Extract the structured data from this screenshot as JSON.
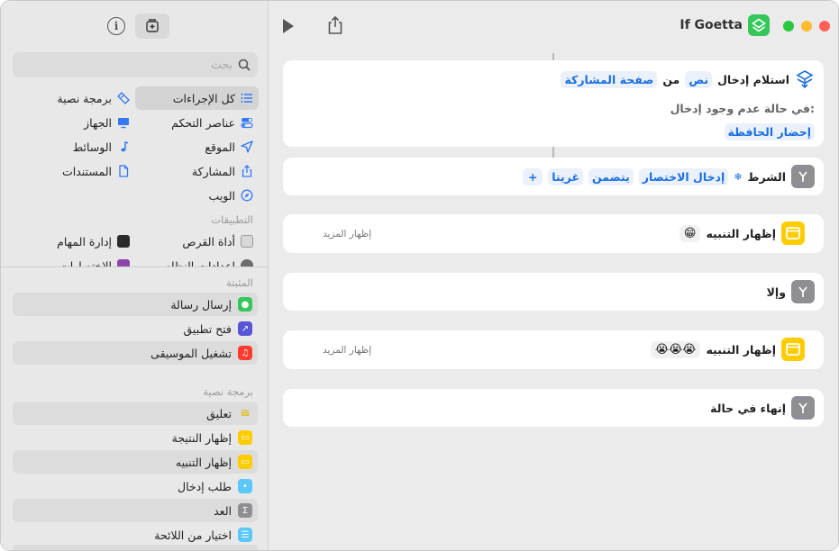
{
  "window": {
    "title": "If Goetta"
  },
  "sidebar": {
    "search_placeholder": "بحث",
    "categories": [
      {
        "label": "كل الإجراءات",
        "icon": "list-icon"
      },
      {
        "label": "برمجة نصية",
        "icon": "scripting-icon"
      },
      {
        "label": "عناصر التحكم",
        "icon": "toggle-icon"
      },
      {
        "label": "الجهاز",
        "icon": "display-icon"
      },
      {
        "label": "الموقع",
        "icon": "location-arrow-icon"
      },
      {
        "label": "الوسائط",
        "icon": "music-note-icon"
      },
      {
        "label": "المشاركة",
        "icon": "share-icon"
      },
      {
        "label": "المستندات",
        "icon": "document-icon"
      },
      {
        "label": "الويب",
        "icon": "compass-icon"
      }
    ],
    "apps_label": "التطبيقات",
    "apps": [
      {
        "label": "أداة القرص",
        "icon": "disk-utility-icon"
      },
      {
        "label": "إدارة المهام",
        "icon": "activity-monitor-icon"
      },
      {
        "label": "إعدادات النظام",
        "icon": "system-settings-icon"
      },
      {
        "label": "الاختصارات",
        "icon": "shortcuts-app-icon"
      }
    ],
    "pinned_label": "المثبتة",
    "pinned": [
      {
        "label": "إرسال رسالة",
        "color": "#34c759"
      },
      {
        "label": "فتح تطبيق",
        "color": "#5856d6"
      },
      {
        "label": "تشغيل الموسيقى",
        "color": "#ff3b30"
      }
    ],
    "scripting_label": "برمجة نصية",
    "scripting": [
      {
        "label": "تعليق",
        "color": "#ffcc00"
      },
      {
        "label": "إظهار النتيجة",
        "color": "#ffcc00"
      },
      {
        "label": "إظهار التنبيه",
        "color": "#ffcc00"
      },
      {
        "label": "طلب إدخال",
        "color": "#5ac8fa"
      },
      {
        "label": "العد",
        "color": "#8e8e93"
      },
      {
        "label": "اختيار من اللائحة",
        "color": "#5ac8fa"
      }
    ]
  },
  "editor": {
    "receive": {
      "title": "استلام إدخال",
      "type": "نص",
      "from": "من",
      "source": "صفحة المشاركة",
      "fallback_label": "في حالة عدم وجود إدخال:",
      "fallback_action": "إحضار الحافظة"
    },
    "if_block": {
      "label": "الشرط",
      "input": "إدخال الاختصار",
      "condition": "يتضمن",
      "value": "غريتا",
      "add": "+"
    },
    "alert1": {
      "label": "إظهار التنبيه",
      "emoji": "😁",
      "more": "إظهار المزيد"
    },
    "otherwise": {
      "label": "وإلا"
    },
    "alert2": {
      "label": "إظهار التنبيه",
      "emoji": "😭😭😭",
      "more": "إظهار المزيد"
    },
    "end_if": {
      "label": "إنهاء في حالة"
    }
  },
  "colors": {
    "accent": "#1d6fe0",
    "green": "#34c759",
    "yellow": "#ffcc00",
    "red": "#ff5f57"
  }
}
